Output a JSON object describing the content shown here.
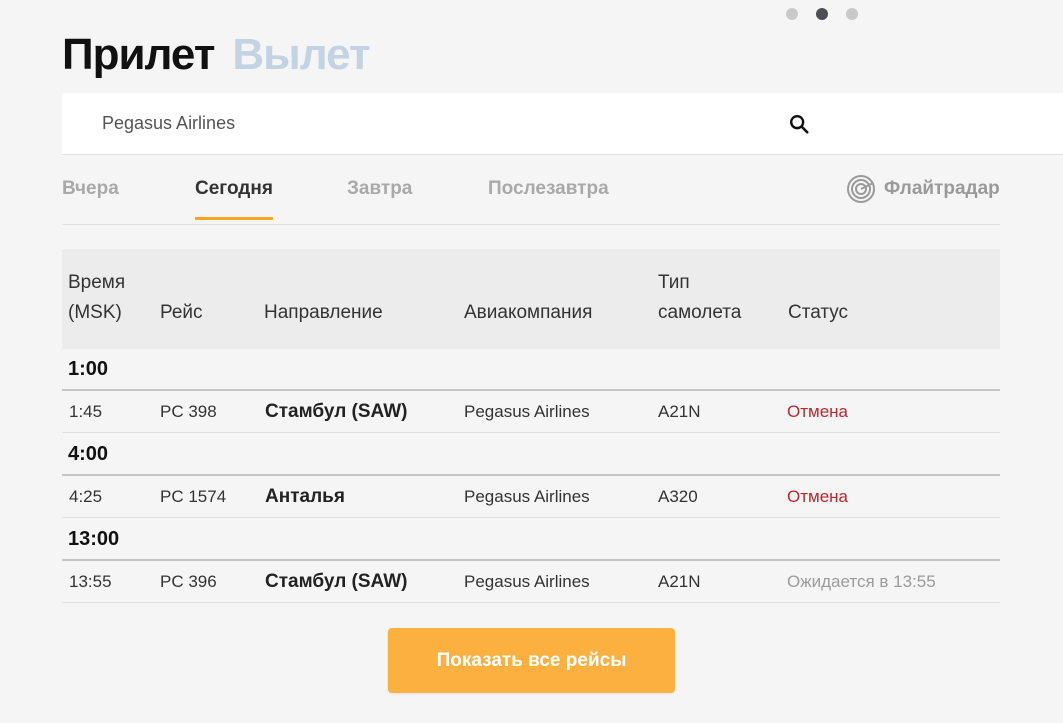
{
  "carousel": {
    "dots": 3,
    "active_index": 1
  },
  "header": {
    "active_tab": "Прилет",
    "inactive_tab": "Вылет"
  },
  "search": {
    "value": "Pegasus Airlines",
    "icon": "search-icon"
  },
  "day_tabs": [
    {
      "label": "Вчера",
      "active": false
    },
    {
      "label": "Сегодня",
      "active": true
    },
    {
      "label": "Завтра",
      "active": false
    },
    {
      "label": "Послезавтра",
      "active": false
    }
  ],
  "flightradar": {
    "label": "Флайтрадар",
    "icon": "radar-icon"
  },
  "table": {
    "columns": {
      "time": [
        "Время",
        "(MSK)"
      ],
      "flight": "Рейс",
      "direction": "Направление",
      "airline": "Авиакомпания",
      "aircraft": [
        "Тип",
        "самолета"
      ],
      "status": "Статус"
    },
    "groups": [
      {
        "label": "1:00",
        "flights": [
          {
            "time": "1:45",
            "flight": "PC 398",
            "direction": "Стамбул (SAW)",
            "airline": "Pegasus Airlines",
            "aircraft": "A21N",
            "status": "Отмена",
            "status_type": "cancel"
          }
        ]
      },
      {
        "label": "4:00",
        "flights": [
          {
            "time": "4:25",
            "flight": "PC 1574",
            "direction": "Анталья",
            "airline": "Pegasus Airlines",
            "aircraft": "A320",
            "status": "Отмена",
            "status_type": "cancel"
          }
        ]
      },
      {
        "label": "13:00",
        "flights": [
          {
            "time": "13:55",
            "flight": "PC 396",
            "direction": "Стамбул (SAW)",
            "airline": "Pegasus Airlines",
            "aircraft": "A21N",
            "status": "Ожидается в 13:55",
            "status_type": "expected"
          }
        ]
      }
    ]
  },
  "show_all_button": "Показать все рейсы",
  "colors": {
    "accent": "#fbb040",
    "tab_underline": "#f5a623",
    "cancel": "#c0262d",
    "expected": "#9b9b9b",
    "inactive_heading": "#c3d3e3"
  }
}
